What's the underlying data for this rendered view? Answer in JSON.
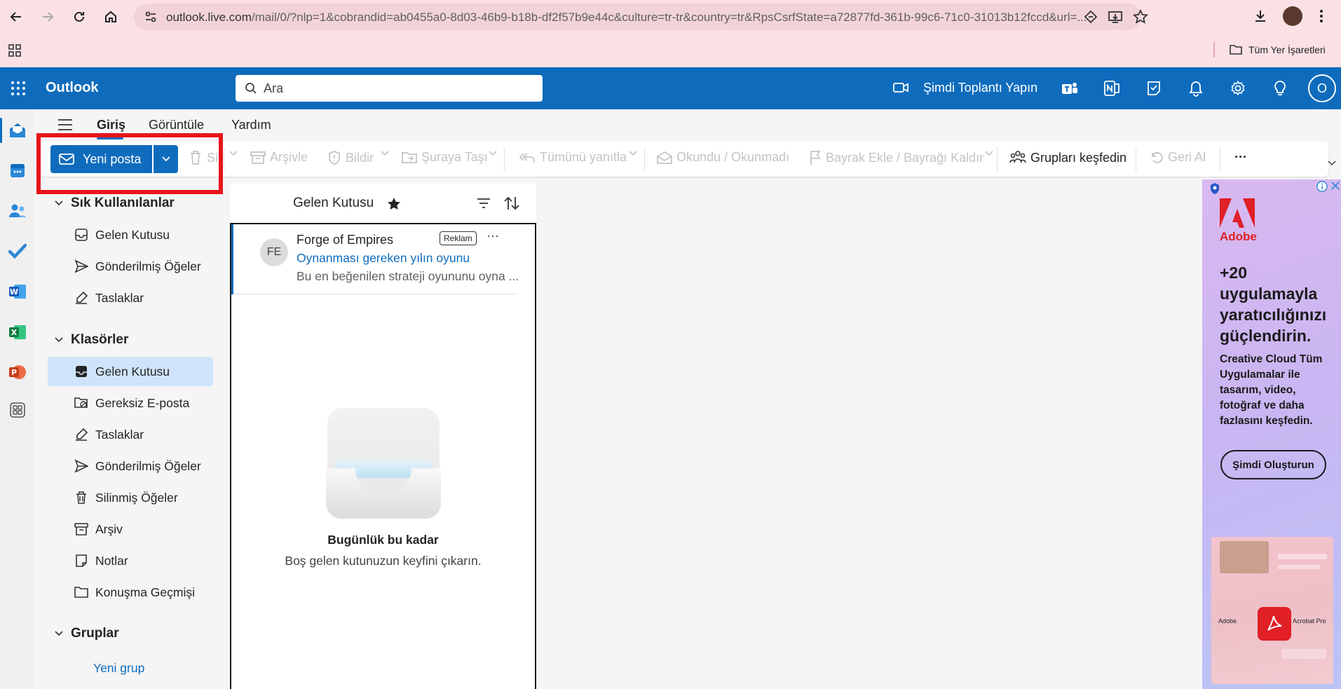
{
  "browser": {
    "url_host": "outlook.live.com",
    "url_rest": "/mail/0/?nlp=1&cobrandid=ab0455a0-8d03-46b9-b18b-df2f57b9e44c&culture=tr-tr&country=tr&RpsCsrfState=a72877fd-361b-99c6-71c0-31013b12fccd&url=...",
    "bookmarks_label": "Tüm Yer İşaretleri"
  },
  "header": {
    "app_name": "Outlook",
    "search_placeholder": "Ara",
    "meet_now_label": "Şimdi Toplantı Yapın",
    "avatar_initial": "O"
  },
  "ribbon_tabs": {
    "home": "Giriş",
    "view": "Görüntüle",
    "help": "Yardım"
  },
  "ribbon": {
    "new_mail": "Yeni posta",
    "delete": "Sil",
    "archive": "Arşivle",
    "report": "Bildir",
    "move_to": "Şuraya Taşı",
    "reply_all": "Tümünü yanıtla",
    "read_unread": "Okundu / Okunmadı",
    "flag": "Bayrak Ekle / Bayrağı Kaldır",
    "discover_groups": "Grupları keşfedin",
    "undo": "Geri Al",
    "more": "···"
  },
  "folders": {
    "favorites_title": "Sık Kullanılanlar",
    "favorites": [
      {
        "label": "Gelen Kutusu",
        "icon": "inbox-icon"
      },
      {
        "label": "Gönderilmiş Öğeler",
        "icon": "send-icon"
      },
      {
        "label": "Taslaklar",
        "icon": "draft-icon"
      }
    ],
    "folders_title": "Klasörler",
    "items": [
      {
        "label": "Gelen Kutusu",
        "icon": "inbox-icon",
        "selected": true
      },
      {
        "label": "Gereksiz E-posta",
        "icon": "junk-icon"
      },
      {
        "label": "Taslaklar",
        "icon": "draft-icon"
      },
      {
        "label": "Gönderilmiş Öğeler",
        "icon": "send-icon"
      },
      {
        "label": "Silinmiş Öğeler",
        "icon": "trash-icon"
      },
      {
        "label": "Arşiv",
        "icon": "archive-icon"
      },
      {
        "label": "Notlar",
        "icon": "notes-icon"
      },
      {
        "label": "Konuşma Geçmişi",
        "icon": "folder-icon"
      }
    ],
    "groups_title": "Gruplar",
    "new_group": "Yeni grup"
  },
  "message_list": {
    "title": "Gelen Kutusu",
    "ad": {
      "avatar": "FE",
      "sender": "Forge of Empires",
      "badge": "Reklam",
      "more": "···",
      "subject": "Oynanması gereken yılın oyunu",
      "preview": "Bu en beğenilen strateji oyununu oyna ..."
    },
    "empty_title": "Bugünlük bu kadar",
    "empty_subtitle": "Boş gelen kutunuzun keyfini çıkarın."
  },
  "ad_panel": {
    "brand": "Adobe",
    "headline": "+20 uygulamayla yaratıcılığınızı güçlendirin.",
    "body": "Creative Cloud Tüm Uygulamalar ile tasarım, video, fotoğraf ve daha fazlasını keşfedin.",
    "cta": "Şimdi Oluşturun",
    "card_left": "Adobe",
    "card_right": "Acrobat Pro"
  },
  "colors": {
    "brand_blue": "#0f6cbd",
    "browser_chrome": "#fbe1e6",
    "highlight_red": "#e8141b",
    "selected_folder": "#cfe4fa"
  }
}
